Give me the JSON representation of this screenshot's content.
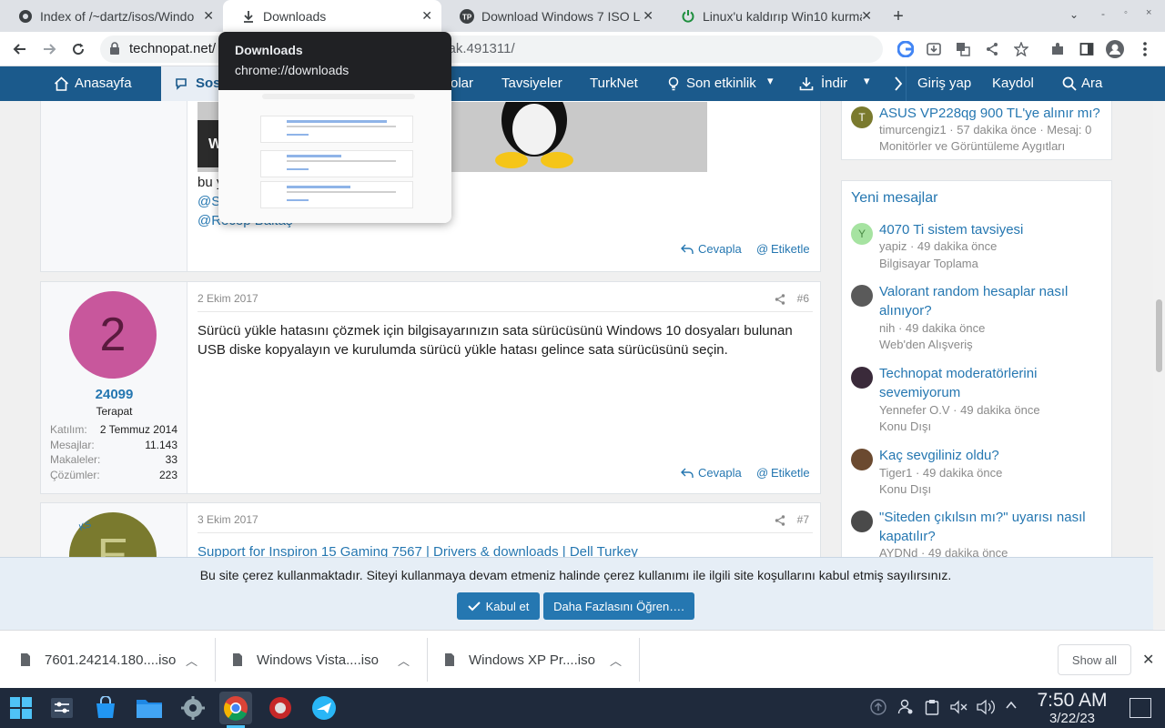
{
  "browser": {
    "tabs": [
      {
        "title": "Index of /~dartz/isos/Windo",
        "icon": "ubuntu-logo-icon"
      },
      {
        "title": "Downloads",
        "icon": "download-icon"
      },
      {
        "title": "Download Windows 7 ISO Le",
        "icon": "technopat-tp-icon"
      },
      {
        "title": "Linux'u kaldırıp Win10 kurma",
        "icon": "power-icon"
      }
    ],
    "new_tab": "+",
    "url_host": "technopat.net/",
    "url_tail": "mak.491311/",
    "hover_card": {
      "title": "Downloads",
      "subtitle": "chrome://downloads"
    }
  },
  "site_nav": {
    "home": "Anasayfa",
    "active": "Sos",
    "partial": "olar",
    "tips": "Tavsiyeler",
    "turknet": "TurkNet",
    "activity": "Son etkinlik",
    "download": "İndir",
    "login": "Giriş yap",
    "register": "Kaydol",
    "search": "Ara"
  },
  "prev_post": {
    "partial_text": "bu y",
    "mention1": "@S",
    "mention2": "@Recep Baltaş",
    "reply": "Cevapla",
    "tag": "Etiketle",
    "image_letter": "W"
  },
  "post6": {
    "avatar_letter": "2",
    "username": "24099",
    "title": "Terapat",
    "stats": [
      {
        "label": "Katılım:",
        "value": "2 Temmuz 2014"
      },
      {
        "label": "Mesajlar:",
        "value": "11.143"
      },
      {
        "label": "Makaleler:",
        "value": "33"
      },
      {
        "label": "Çözümler:",
        "value": "223"
      }
    ],
    "date": "2 Ekim 2017",
    "number": "#6",
    "body": "Sürücü yükle hatasını çözmek için bilgisayarınızın sata sürücüsünü Windows 10 dosyaları bulunan USB diske kopyalayın ve kurulumda sürücü yükle hatası gelince sata sürücüsünü seçin.",
    "reply": "Cevapla",
    "tag": "Etiketle"
  },
  "post7": {
    "avatar_letter": "E",
    "avatar_badge": "KS",
    "date": "3 Ekim 2017",
    "number": "#7",
    "link": "Support for Inspiron 15 Gaming 7567 | Drivers & downloads | Dell Turkey"
  },
  "sidebar_top": {
    "title": "ASUS VP228qg 900 TL'ye alınır mı?",
    "meta": "timurcengiz1 · 57 dakika önce · Mesaj: 0",
    "forum": "Monitörler ve Görüntüleme Aygıtları",
    "avatar": "T"
  },
  "new_messages": {
    "heading": "Yeni mesajlar",
    "items": [
      {
        "title": "4070 Ti sistem tavsiyesi",
        "meta": "yapiz · 49 dakika önce",
        "forum": "Bilgisayar Toplama",
        "avatar": "Y"
      },
      {
        "title": "Valorant random hesaplar nasıl alınıyor?",
        "meta": "nih · 49 dakika önce",
        "forum": "Web'den Alışveriş",
        "avatar": ""
      },
      {
        "title": "Technopat moderatörlerini sevemiyorum",
        "meta": "Yennefer O.V · 49 dakika önce",
        "forum": "Konu Dışı",
        "avatar": ""
      },
      {
        "title": "Kaç sevgiliniz oldu?",
        "meta": "Tiger1 · 49 dakika önce",
        "forum": "Konu Dışı",
        "avatar": ""
      },
      {
        "title": "\"Siteden çıkılsın mı?\" uyarısı nasıl kapatılır?",
        "meta": "AYDNd · 49 dakika önce",
        "forum": "",
        "avatar": ""
      }
    ]
  },
  "cookie": {
    "text": "Bu site çerez kullanmaktadır. Siteyi kullanmaya devam etmeniz halinde çerez kullanımı ile ilgili site koşullarını kabul etmiş sayılırsınız.",
    "accept": "Kabul et",
    "learn_more": "Daha Fazlasını Öğren…."
  },
  "downloads": {
    "items": [
      "7601.24214.180....iso",
      "Windows Vista....iso",
      "Windows XP Pr....iso"
    ],
    "show_all": "Show all"
  },
  "taskbar": {
    "time": "7:50 AM",
    "date": "3/22/23"
  },
  "colors": {
    "site_blue": "#1b5a8c",
    "link_blue": "#2577b1",
    "avatar_pink": "#c8579c",
    "avatar_olive": "#7a7a2e"
  }
}
